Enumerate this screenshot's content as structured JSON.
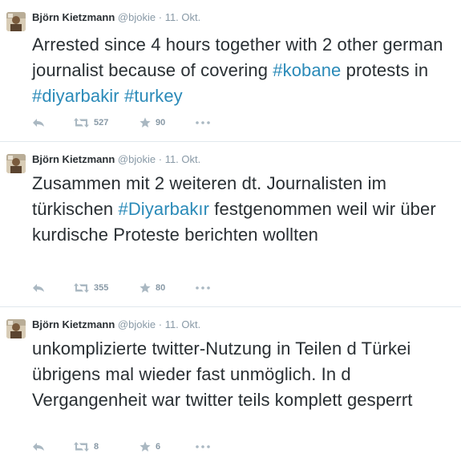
{
  "tweets": [
    {
      "fullname": "Björn Kietzmann",
      "username": "@bjokie",
      "separator": "·",
      "time": "11. Okt.",
      "text_parts": [
        "Arrested since 4 hours together with 2 other german journalist because of covering ",
        "#kobane",
        " protests in ",
        "#diyarbakir",
        " ",
        "#turkey"
      ],
      "retweets": "527",
      "favorites": "90"
    },
    {
      "fullname": "Björn Kietzmann",
      "username": "@bjokie",
      "separator": "·",
      "time": "11. Okt.",
      "text_parts": [
        "Zusammen mit 2 weiteren dt. Journalisten im türkischen ",
        "#Diyarbakır",
        " festgenommen weil wir über kurdische Proteste berichten wollten"
      ],
      "retweets": "355",
      "favorites": "80"
    },
    {
      "fullname": "Björn Kietzmann",
      "username": "@bjokie",
      "separator": "·",
      "time": "11. Okt.",
      "text": "unkomplizierte twitter-Nutzung in Teilen d Türkei übrigens mal wieder fast unmöglich. In d Vergangenheit war twitter teils komplett gesperrt",
      "retweets": "8",
      "favorites": "6"
    }
  ],
  "icons": {
    "reply": "reply-icon",
    "retweet": "retweet-icon",
    "favorite": "star-icon",
    "more": "more-icon"
  },
  "colors": {
    "text": "#292f33",
    "muted": "#8899a6",
    "hashtag": "#2a8ab8",
    "action_icon": "#aab8c2",
    "divider": "#e1e8ed"
  }
}
